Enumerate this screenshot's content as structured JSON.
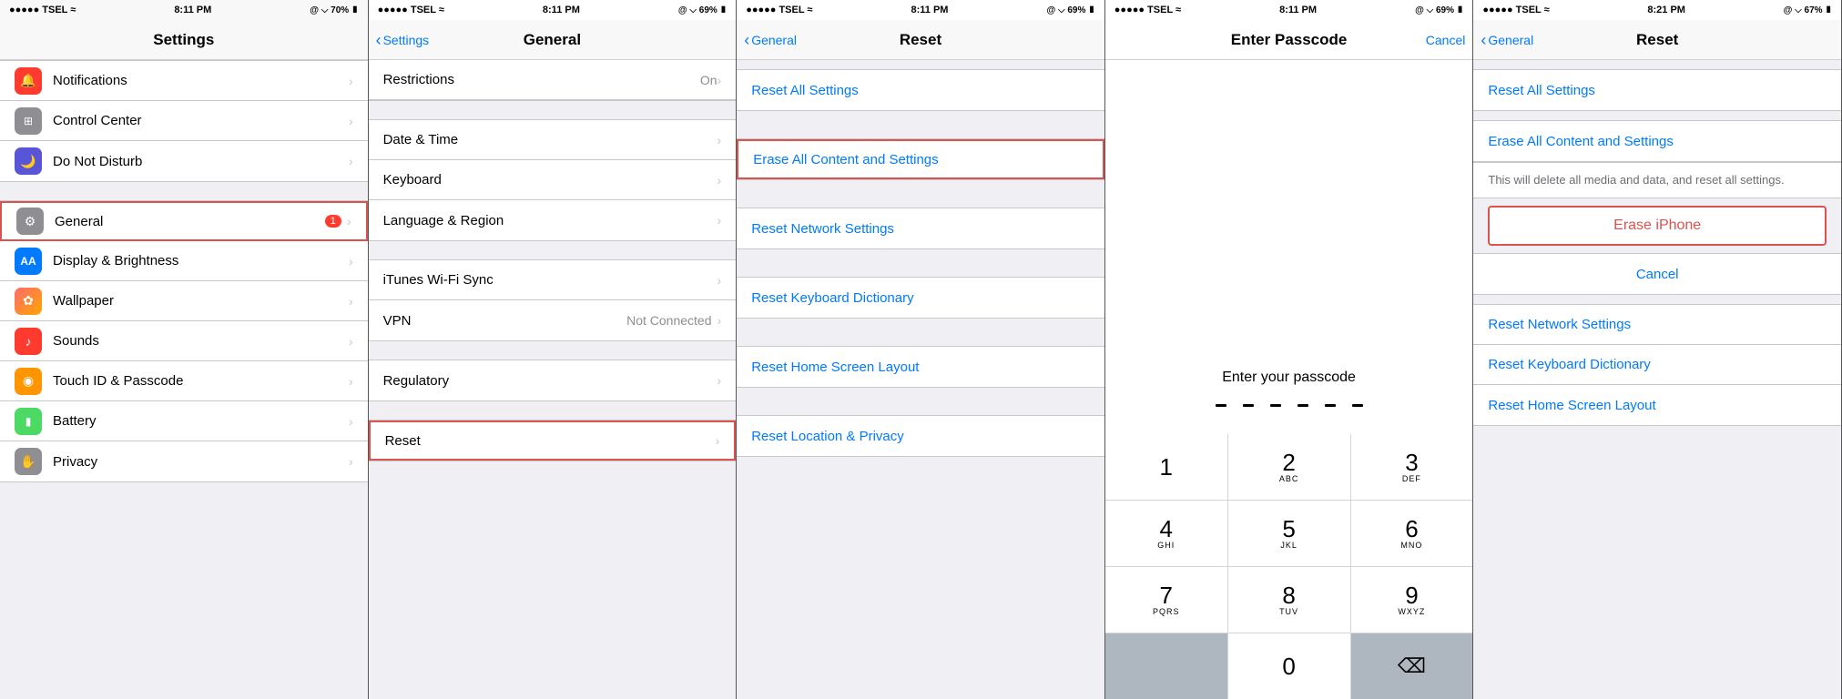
{
  "panels": [
    {
      "id": "panel1",
      "statusBar": {
        "left": "●●●●● TSEL  ≈",
        "center": "8:11 PM",
        "right": "@ ⌵ 70% ▮"
      },
      "navBar": {
        "title": "Settings",
        "backLabel": "",
        "rightLabel": ""
      },
      "groups": [
        {
          "items": [
            {
              "icon": "🔴",
              "iconBg": "#ff3b30",
              "label": "Notifications",
              "badge": "",
              "value": "",
              "isSelected": false
            },
            {
              "icon": "⚙",
              "iconBg": "#8e8e93",
              "label": "Control Center",
              "badge": "",
              "value": "",
              "isSelected": false
            },
            {
              "icon": "🌙",
              "iconBg": "#5856d6",
              "label": "Do Not Disturb",
              "badge": "",
              "value": "",
              "isSelected": false
            }
          ]
        },
        {
          "items": [
            {
              "icon": "⚙",
              "iconBg": "#8e8e93",
              "label": "General",
              "badge": "1",
              "value": "",
              "isSelected": true
            },
            {
              "icon": "AA",
              "iconBg": "#007aff",
              "label": "Display & Brightness",
              "badge": "",
              "value": "",
              "isSelected": false
            },
            {
              "icon": "✿",
              "iconBg": "#ff6b6b",
              "label": "Wallpaper",
              "badge": "",
              "value": "",
              "isSelected": false
            },
            {
              "icon": "♪",
              "iconBg": "#ff3b30",
              "label": "Sounds",
              "badge": "",
              "value": "",
              "isSelected": false
            },
            {
              "icon": "◉",
              "iconBg": "#ff9500",
              "label": "Touch ID & Passcode",
              "badge": "",
              "value": "",
              "isSelected": false
            },
            {
              "icon": "▮",
              "iconBg": "#4cd964",
              "label": "Battery",
              "badge": "",
              "value": "",
              "isSelected": false
            },
            {
              "icon": "✋",
              "iconBg": "#8e8e93",
              "label": "Privacy",
              "badge": "",
              "value": "",
              "isSelected": false
            }
          ]
        }
      ]
    },
    {
      "id": "panel2",
      "statusBar": {
        "left": "●●●●● TSEL  ≈",
        "center": "8:11 PM",
        "right": "@ ⌵ 69% ▮"
      },
      "navBar": {
        "title": "General",
        "backLabel": "Settings",
        "rightLabel": ""
      },
      "partialItems": [
        {
          "label": "Restrictions",
          "value": "On"
        }
      ],
      "groups": [
        {
          "items": [
            {
              "label": "Date & Time",
              "value": ""
            },
            {
              "label": "Keyboard",
              "value": ""
            },
            {
              "label": "Language & Region",
              "value": ""
            }
          ]
        },
        {
          "items": [
            {
              "label": "iTunes Wi-Fi Sync",
              "value": ""
            },
            {
              "label": "VPN",
              "value": "Not Connected"
            }
          ]
        },
        {
          "items": [
            {
              "label": "Regulatory",
              "value": ""
            }
          ]
        },
        {
          "items": [
            {
              "label": "Reset",
              "value": "",
              "isSelected": true
            }
          ]
        }
      ]
    },
    {
      "id": "panel3",
      "statusBar": {
        "left": "●●●●● TSEL  ≈",
        "center": "8:11 PM",
        "right": "@ ⌵ 69% ▮"
      },
      "navBar": {
        "title": "Reset",
        "backLabel": "General",
        "rightLabel": ""
      },
      "resetItems": [
        {
          "label": "Reset All Settings",
          "isHighlighted": false,
          "isRed": false
        },
        {
          "label": "Erase All Content and Settings",
          "isHighlighted": true,
          "isRed": false
        },
        {
          "label": "Reset Network Settings",
          "isHighlighted": false,
          "isRed": false
        },
        {
          "label": "Reset Keyboard Dictionary",
          "isHighlighted": false,
          "isRed": false
        },
        {
          "label": "Reset Home Screen Layout",
          "isHighlighted": false,
          "isRed": false
        },
        {
          "label": "Reset Location & Privacy",
          "isHighlighted": false,
          "isRed": false
        }
      ]
    },
    {
      "id": "panel4",
      "statusBar": {
        "left": "●●●●● TSEL  ≈",
        "center": "8:11 PM",
        "right": "@ ⌵ 69% ▮"
      },
      "navBar": {
        "title": "Enter Passcode",
        "backLabel": "",
        "rightLabel": "Cancel"
      },
      "passcode": {
        "title": "Enter your passcode",
        "dots": 6
      },
      "numpad": [
        {
          "num": "1",
          "letters": ""
        },
        {
          "num": "2",
          "letters": "ABC"
        },
        {
          "num": "3",
          "letters": "DEF"
        },
        {
          "num": "4",
          "letters": "GHI"
        },
        {
          "num": "5",
          "letters": "JKL"
        },
        {
          "num": "6",
          "letters": "MNO"
        },
        {
          "num": "7",
          "letters": "PQRS"
        },
        {
          "num": "8",
          "letters": "TUV"
        },
        {
          "num": "9",
          "letters": "WXYZ"
        },
        {
          "num": "",
          "letters": "",
          "isDark": true
        },
        {
          "num": "0",
          "letters": ""
        },
        {
          "num": "⌫",
          "letters": "",
          "isDark": true,
          "isDelete": true
        }
      ]
    },
    {
      "id": "panel5",
      "statusBar": {
        "left": "●●●●● TSEL  ≈",
        "center": "8:21 PM",
        "right": "@ ⌵ 67% ▮"
      },
      "navBar": {
        "title": "Reset",
        "backLabel": "General",
        "rightLabel": ""
      },
      "resetItems": [
        {
          "label": "Reset All Settings",
          "isHighlighted": false
        },
        {
          "label": "Erase All Content and Settings",
          "isHighlighted": false
        }
      ],
      "confirmText": "This will delete all media and data, and reset all settings.",
      "eraseLabel": "Erase iPhone",
      "cancelLabel": "Cancel",
      "moreItems": [
        {
          "label": "Reset Network Settings"
        },
        {
          "label": "Reset Keyboard Dictionary"
        },
        {
          "label": "Reset Home Screen Layout"
        }
      ]
    }
  ]
}
